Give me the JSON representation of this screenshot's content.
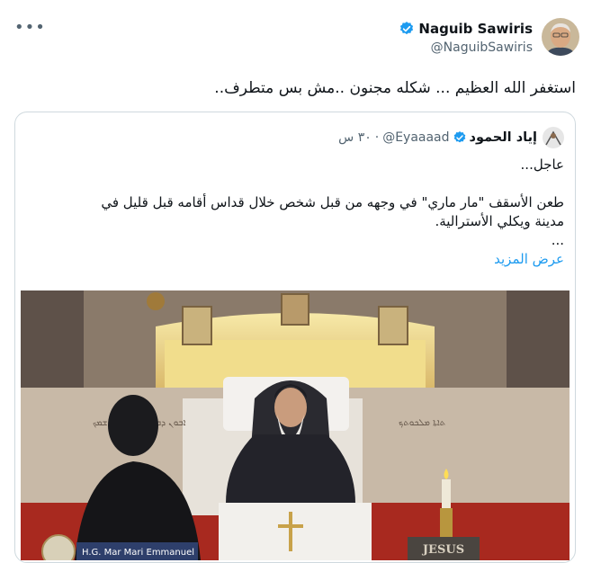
{
  "tweet": {
    "more_icon": "more-horizontal-icon",
    "author_name": "Naguib Sawiris",
    "author_handle": "@NaguibSawiris",
    "text": "استغفر الله العظيم ... شكله مجنون ..مش بس متطرف..",
    "verified_color": "#1d9bf0"
  },
  "quote": {
    "author_name": "إياد الحمود",
    "author_handle": "@Eyaaaad",
    "time": "٣٠ س",
    "line1": "عاجل...",
    "line2": "طعن الأسقف \"مار ماري\" في وجهه من قبل شخص خلال قداس أقامه قبل قليل في",
    "line3": "مدينة ويكلي الأسترالية.",
    "ellipsis": "...",
    "show_more": "عرض المزيد",
    "media": {
      "lower_banner": "H.G. Mar Mari Emmanuel",
      "jesus_sign": "JESUS"
    }
  }
}
